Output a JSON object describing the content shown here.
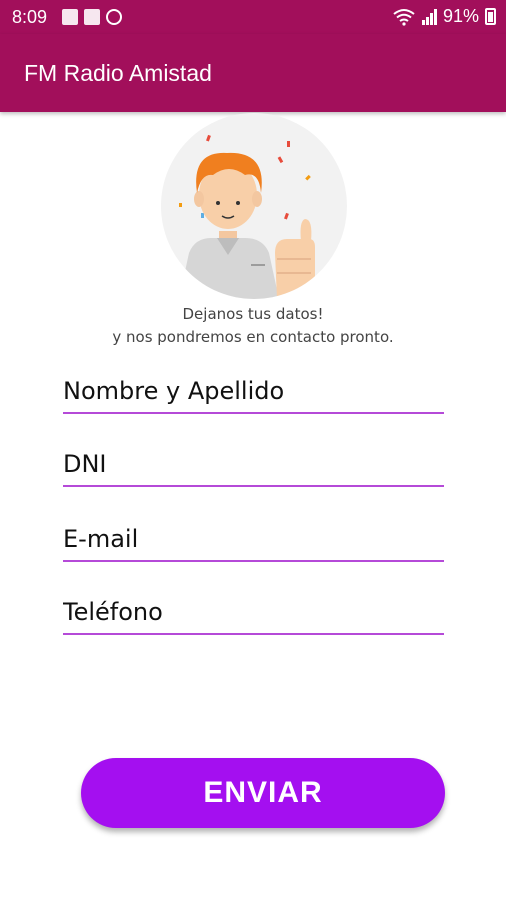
{
  "status_bar": {
    "time": "8:09",
    "battery": "91%"
  },
  "app_bar": {
    "title": "FM Radio Amistad"
  },
  "intro": {
    "line1": "Dejanos tus datos!",
    "line2": "y nos pondremos en contacto pronto."
  },
  "form": {
    "name_placeholder": "Nombre y Apellido",
    "dni_placeholder": "DNI",
    "email_placeholder": "E-mail",
    "phone_placeholder": "Teléfono",
    "submit_label": "ENVIAR"
  },
  "colors": {
    "primary": "#a20f5b",
    "accent": "#a40ff0",
    "underline": "#b54ad8"
  }
}
